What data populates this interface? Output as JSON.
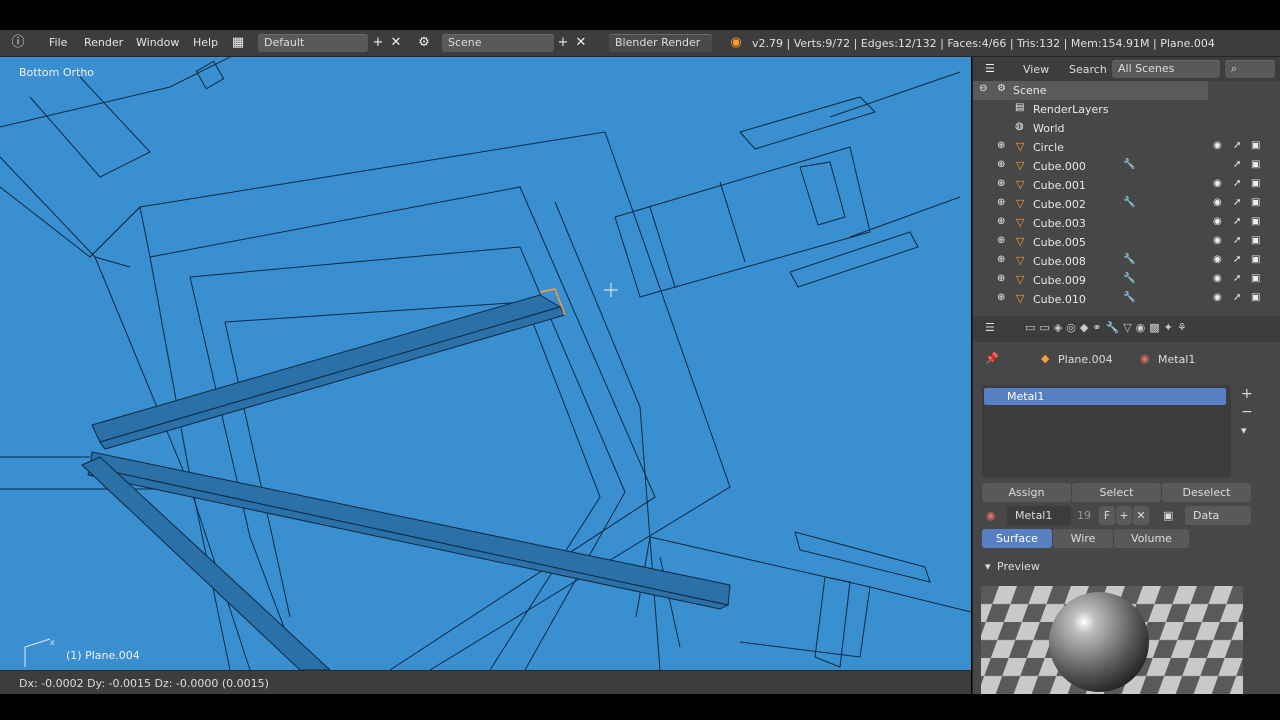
{
  "menu": {
    "file": "File",
    "render": "Render",
    "window": "Window",
    "help": "Help"
  },
  "layout_field": "Default",
  "scene_field": "Scene",
  "engine_field": "Blender Render",
  "stats": "v2.79 | Verts:9/72 | Edges:12/132 | Faces:4/66 | Tris:132 | Mem:154.91M | Plane.004",
  "viewport": {
    "view_label": "Bottom Ortho",
    "object_label": "(1) Plane.004",
    "axis_x_label": "x"
  },
  "statusbar": {
    "text": "Dx: -0.0002  Dy: -0.0015  Dz: -0.0000 (0.0015)"
  },
  "outliner": {
    "view": "View",
    "search": "Search",
    "filter": "All Scenes",
    "items": [
      {
        "label": "Scene"
      },
      {
        "label": "RenderLayers"
      },
      {
        "label": "World"
      },
      {
        "label": "Circle"
      },
      {
        "label": "Cube.000"
      },
      {
        "label": "Cube.001"
      },
      {
        "label": "Cube.002"
      },
      {
        "label": "Cube.003"
      },
      {
        "label": "Cube.005"
      },
      {
        "label": "Cube.008"
      },
      {
        "label": "Cube.009"
      },
      {
        "label": "Cube.010"
      }
    ]
  },
  "properties": {
    "object": "Plane.004",
    "material": "Metal1",
    "slot_name": "Metal1",
    "assign": "Assign",
    "select": "Select",
    "deselect": "Deselect",
    "mat_name": "Metal1",
    "users": "19",
    "fake": "F",
    "link": "Data",
    "tabs": [
      "Surface",
      "Wire",
      "Volume"
    ],
    "preview_title": "Preview"
  },
  "colors": {
    "viewport_bg": "#3a8fd0",
    "selected": "#5680c2",
    "object_orange": "#ff9c2a"
  }
}
